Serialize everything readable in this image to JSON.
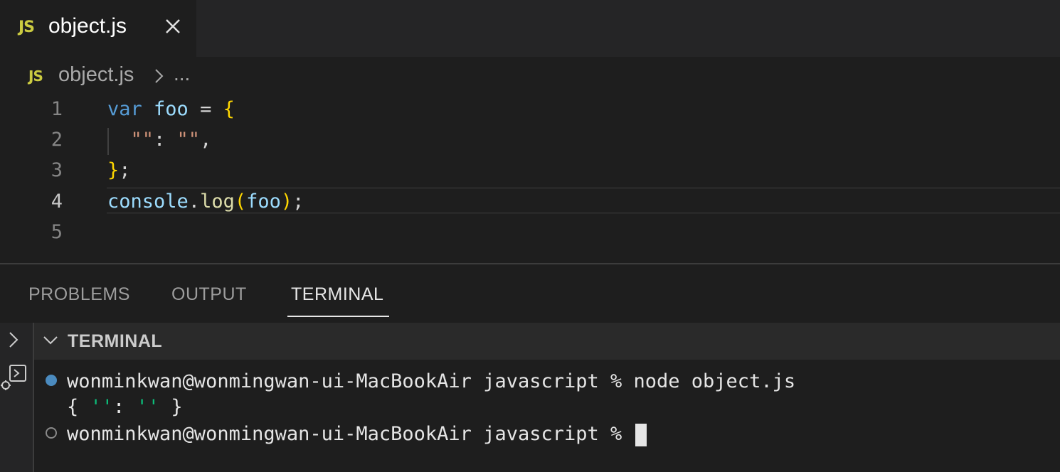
{
  "tab": {
    "icon": "JS",
    "filename": "object.js",
    "close_symbol": "×"
  },
  "breadcrumb": {
    "icon": "JS",
    "file": "object.js",
    "separator": ">",
    "rest": "..."
  },
  "editor": {
    "line_numbers": [
      "1",
      "2",
      "3",
      "4",
      "5"
    ],
    "active_line": "4",
    "code": {
      "l1_kw": "var",
      "l1_var": "foo",
      "l1_op": " = ",
      "l1_brace": "{",
      "l2_key": "\"\"",
      "l2_colon": ": ",
      "l2_val": "\"\"",
      "l2_comma": ",",
      "l3_brace": "}",
      "l3_semi": ";",
      "l4_obj": "console",
      "l4_dot": ".",
      "l4_fn": "log",
      "l4_open": "(",
      "l4_arg": "foo",
      "l4_close": ")",
      "l4_semi": ";"
    }
  },
  "panel": {
    "tabs": [
      "PROBLEMS",
      "OUTPUT",
      "TERMINAL"
    ],
    "active_tab": "TERMINAL",
    "section_title": "TERMINAL"
  },
  "terminal": {
    "prompt1": "wonminkwan@wonmingwan-ui-MacBookAir javascript % node object.js",
    "output_open": "{ ",
    "output_key": "''",
    "output_colon": ": ",
    "output_val": "''",
    "output_close": " }",
    "prompt2": "wonminkwan@wonmingwan-ui-MacBookAir javascript % "
  },
  "colors": {
    "accent_js": "#cbcb41",
    "keyword": "#569cd6",
    "variable": "#9cdcfe",
    "string": "#ce9178",
    "function": "#dcdcaa",
    "bracket": "#ffd700",
    "terminal_string": "#0dbc79",
    "dot_active": "#4b8bbf"
  }
}
